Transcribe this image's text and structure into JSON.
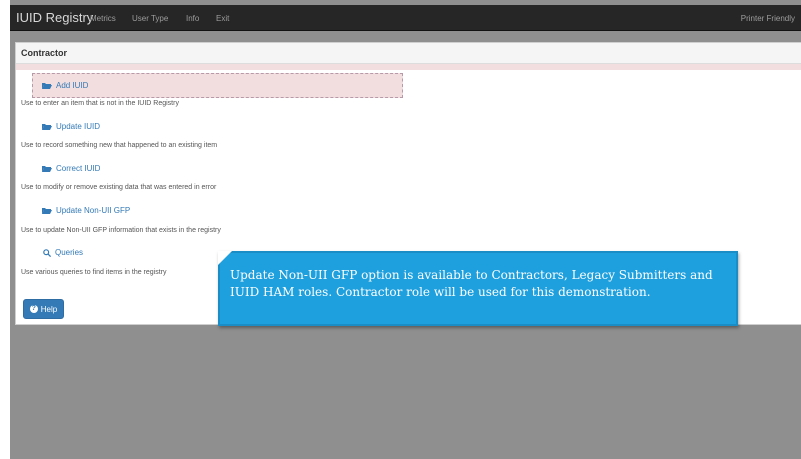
{
  "app": {
    "brand": "IUID Registry",
    "nav": [
      "Metrics",
      "User Type",
      "Info",
      "Exit"
    ],
    "right_link": "Printer Friendly"
  },
  "panel": {
    "title": "Contractor",
    "actions": [
      {
        "label": "Add IUID",
        "icon": "folder-open-icon",
        "description": "Use to enter an item that is not in the IUID Registry",
        "selected": true
      },
      {
        "label": "Update IUID",
        "icon": "folder-open-icon",
        "description": "Use to record something new that happened to an existing item",
        "selected": false
      },
      {
        "label": "Correct IUID",
        "icon": "folder-open-icon",
        "description": "Use to modify or remove existing data that was entered in error",
        "selected": false
      },
      {
        "label": "Update Non-UII GFP",
        "icon": "folder-open-icon",
        "description": "Use to update Non-UII GFP information that exists in the registry",
        "selected": false
      },
      {
        "label": "Queries",
        "icon": "search-icon",
        "description": "Use various queries to find items in the registry",
        "selected": false
      }
    ],
    "help_label": "Help"
  },
  "callout": {
    "text": "Update Non-UII GFP option is available to Contractors, Legacy Submitters and IUID HAM roles. Contractor role will be used for this demonstration."
  },
  "colors": {
    "link": "#337ab7",
    "highlight": "#f2dede",
    "callout": "#1e9fde",
    "navbar": "#262626"
  }
}
